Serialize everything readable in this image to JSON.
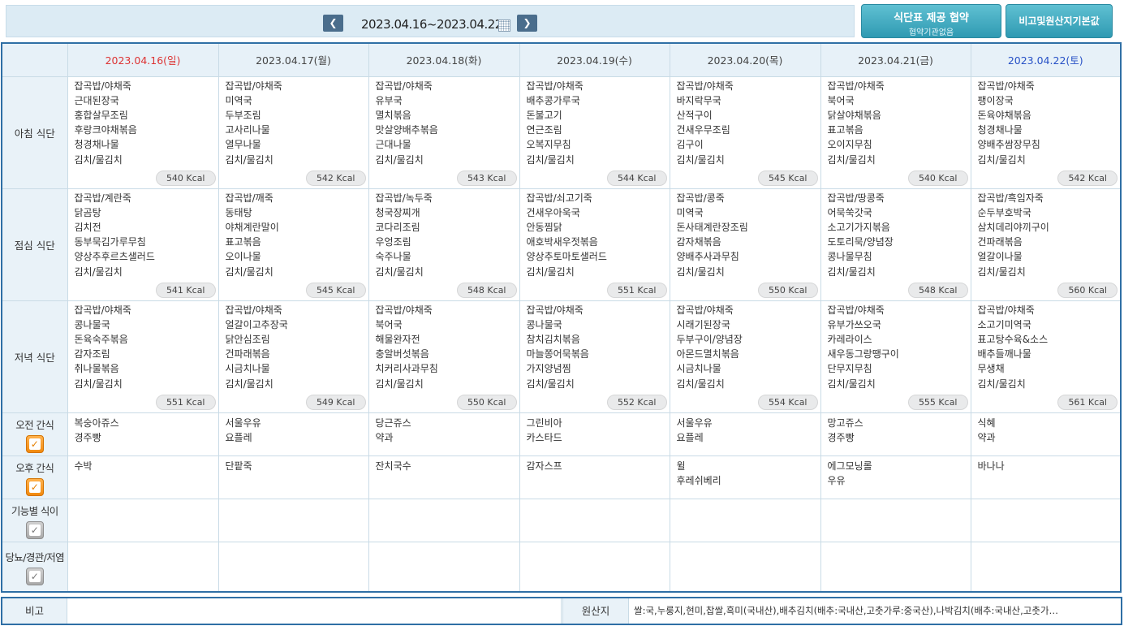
{
  "nav": {
    "prev_symbol": "❮",
    "next_symbol": "❯",
    "date_range": "2023.04.16~2023.04.22"
  },
  "buttons": {
    "contract_title": "식단표 제공 협약",
    "contract_sub": "협약기관없음",
    "origin_label": "비고및원산지기본값"
  },
  "days": [
    {
      "label": "2023.04.16(일)",
      "type": "sun"
    },
    {
      "label": "2023.04.17(월)",
      "type": ""
    },
    {
      "label": "2023.04.18(화)",
      "type": ""
    },
    {
      "label": "2023.04.19(수)",
      "type": ""
    },
    {
      "label": "2023.04.20(목)",
      "type": ""
    },
    {
      "label": "2023.04.21(금)",
      "type": ""
    },
    {
      "label": "2023.04.22(토)",
      "type": "sat"
    }
  ],
  "meals": [
    {
      "label": "아침 식단",
      "cells": [
        {
          "items": [
            "잡곡밥/야채죽",
            "근대된장국",
            "홍합살무조림",
            "후랑크야채볶음",
            "청경채나물",
            "김치/물김치"
          ],
          "kcal": "540 Kcal"
        },
        {
          "items": [
            "잡곡밥/야채죽",
            "미역국",
            "두부조림",
            "고사리나물",
            "열무나물",
            "김치/물김치"
          ],
          "kcal": "542 Kcal"
        },
        {
          "items": [
            "잡곡밥/야채죽",
            "유부국",
            "멸치볶음",
            "맛살양배추볶음",
            "근대나물",
            "김치/물김치"
          ],
          "kcal": "543 Kcal"
        },
        {
          "items": [
            "잡곡밥/야채죽",
            "배추콩가루국",
            "돈불고기",
            "연근조림",
            "오복지무침",
            "김치/물김치"
          ],
          "kcal": "544 Kcal"
        },
        {
          "items": [
            "잡곡밥/야채죽",
            "바지락무국",
            "산적구이",
            "건새우무조림",
            "김구이",
            "김치/물김치"
          ],
          "kcal": "545 Kcal"
        },
        {
          "items": [
            "잡곡밥/야채죽",
            "북어국",
            "닭살야채볶음",
            "표고볶음",
            "오이지무침",
            "김치/물김치"
          ],
          "kcal": "540 Kcal"
        },
        {
          "items": [
            "잡곡밥/야채죽",
            "팽이장국",
            "돈육야채볶음",
            "청경채나물",
            "양배추쌈장무침",
            "김치/물김치"
          ],
          "kcal": "542 Kcal"
        }
      ]
    },
    {
      "label": "점심 식단",
      "cells": [
        {
          "items": [
            "잡곡밥/계란죽",
            "닭곰탕",
            "김치전",
            "동부묵김가루무침",
            "양상추후르츠샐러드",
            "김치/물김치"
          ],
          "kcal": "541 Kcal"
        },
        {
          "items": [
            "잡곡밥/깨죽",
            "동태탕",
            "야채계란말이",
            "표고볶음",
            "오이나물",
            "김치/물김치"
          ],
          "kcal": "545 Kcal"
        },
        {
          "items": [
            "잡곡밥/녹두죽",
            "청국장찌개",
            "코다리조림",
            "우엉조림",
            "숙주나물",
            "김치/물김치"
          ],
          "kcal": "548 Kcal"
        },
        {
          "items": [
            "잡곡밥/쇠고기죽",
            "건새우아욱국",
            "안동찜닭",
            "애호박새우젓볶음",
            "양상추토마토샐러드",
            "김치/물김치"
          ],
          "kcal": "551 Kcal"
        },
        {
          "items": [
            "잡곡밥/콩죽",
            "미역국",
            "돈사태계란장조림",
            "감자채볶음",
            "양배추사과무침",
            "김치/물김치"
          ],
          "kcal": "550 Kcal"
        },
        {
          "items": [
            "잡곡밥/땅콩죽",
            "어묵쑥갓국",
            "소고기가지볶음",
            "도토리묵/양념장",
            "콩나물무침",
            "김치/물김치"
          ],
          "kcal": "548 Kcal"
        },
        {
          "items": [
            "잡곡밥/흑임자죽",
            "순두부호박국",
            "삼치데리야끼구이",
            "건파래볶음",
            "얼갈이나물",
            "김치/물김치"
          ],
          "kcal": "560 Kcal"
        }
      ]
    },
    {
      "label": "저녁 식단",
      "cells": [
        {
          "items": [
            "잡곡밥/야채죽",
            "콩나물국",
            "돈육숙주볶음",
            "감자조림",
            "취나물볶음",
            "김치/물김치"
          ],
          "kcal": "551 Kcal"
        },
        {
          "items": [
            "잡곡밥/야채죽",
            "얼갈이고추장국",
            "닭안심조림",
            "건파래볶음",
            "시금치나물",
            "김치/물김치"
          ],
          "kcal": "549 Kcal"
        },
        {
          "items": [
            "잡곡밥/야채죽",
            "북어국",
            "해물완자전",
            "충알버섯볶음",
            "치커리사과무침",
            "김치/물김치"
          ],
          "kcal": "550 Kcal"
        },
        {
          "items": [
            "잡곡밥/야채죽",
            "콩나물국",
            "참치김치볶음",
            "마늘쫑어묵볶음",
            "가지양념찜",
            "김치/물김치"
          ],
          "kcal": "552 Kcal"
        },
        {
          "items": [
            "잡곡밥/야채죽",
            "시래기된장국",
            "두부구이/양념장",
            "아몬드멸치볶음",
            "시금치나물",
            "김치/물김치"
          ],
          "kcal": "554 Kcal"
        },
        {
          "items": [
            "잡곡밥/야채죽",
            "유부가쓰오국",
            "카레라이스",
            "새우동그랑땡구이",
            "단무지무침",
            "김치/물김치"
          ],
          "kcal": "555 Kcal"
        },
        {
          "items": [
            "잡곡밥/야채죽",
            "소고기미역국",
            "표고탕수육&소스",
            "배추들깨나물",
            "무생채",
            "김치/물김치"
          ],
          "kcal": "561 Kcal"
        }
      ]
    }
  ],
  "snacks": [
    {
      "label": "오전 간식",
      "checked": true,
      "cells": [
        [
          "복숭아쥬스",
          "경주빵"
        ],
        [
          "서울우유",
          "요플레"
        ],
        [
          "당근쥬스",
          "약과"
        ],
        [
          "그린비아",
          "카스타드"
        ],
        [
          "서울우유",
          "요플레"
        ],
        [
          "망고쥬스",
          "경주빵"
        ],
        [
          "식혜",
          "약과"
        ]
      ]
    },
    {
      "label": "오후 간식",
      "checked": true,
      "cells": [
        [
          "수박"
        ],
        [
          "단팥죽"
        ],
        [
          "잔치국수"
        ],
        [
          "감자스프"
        ],
        [
          "윌",
          "후레쉬베리"
        ],
        [
          "에그모닝롤",
          "우유"
        ],
        [
          "바나나"
        ]
      ]
    },
    {
      "label": "기능별 식이",
      "checked": false,
      "cells": [
        [],
        [],
        [],
        [],
        [],
        [],
        []
      ]
    },
    {
      "label": "당뇨/경관/저염",
      "checked": false,
      "cells": [
        [],
        [],
        [],
        [],
        [],
        [],
        []
      ]
    }
  ],
  "bottom": {
    "remarks_label": "비고",
    "origin_label": "원산지",
    "origin_text": "쌀:국,누룽지,현미,찹쌀,흑미(국내산),배추김치(배추:국내산,고춧가루:중국산),나박김치(배추:국내산,고춧가…"
  }
}
